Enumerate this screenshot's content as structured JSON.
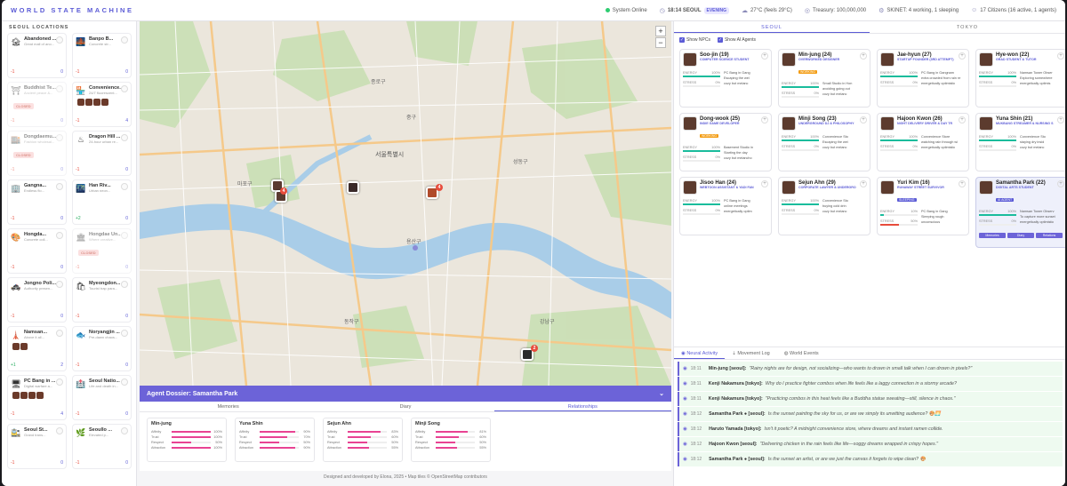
{
  "header": {
    "title": "WORLD STATE MACHINE",
    "system_status": "System Online",
    "time": "18:14 SEOUL",
    "time_badge": "EVENING",
    "weather": "27°C (feels 29°C)",
    "treasury": "Treasury: 100,000,000",
    "skinet": "SKINET: 4 working, 1 sleeping",
    "citizens": "17 Citizens (16 active, 1 agents)"
  },
  "locations": {
    "heading": "SEOUL LOCATIONS",
    "items": [
      {
        "name": "Abandoned ...",
        "sub": "Great mall of ano...",
        "icon": "🏚",
        "delta": "-1",
        "count": "0"
      },
      {
        "name": "Banpo B...",
        "sub": "Concrete str...",
        "icon": "🌉",
        "delta": "-1",
        "count": "0"
      },
      {
        "name": "Buddhist Te...",
        "sub": "Ancient peace &...",
        "icon": "⛩",
        "delta": "-1",
        "count": "0",
        "closed": "CLOSED"
      },
      {
        "name": "Convenience...",
        "sub": "24/7 fluorescent...",
        "icon": "🏪",
        "delta": "-1",
        "count": "4",
        "avatars": 4
      },
      {
        "name": "Dongdaemu...",
        "sub": "Fashion wholesal...",
        "icon": "🏬",
        "delta": "-1",
        "count": "0",
        "closed": "CLOSED"
      },
      {
        "name": "Dragon Hill ...",
        "sub": "24-hour urban re...",
        "icon": "♨",
        "delta": "-1",
        "count": "0"
      },
      {
        "name": "Gangna...",
        "sub": "Endless flo...",
        "icon": "🏢",
        "delta": "-1",
        "count": "0"
      },
      {
        "name": "Han Riv...",
        "sub": "Urban neon...",
        "icon": "🌃",
        "delta": "+2",
        "count": "0"
      },
      {
        "name": "Hongda...",
        "sub": "Concrete coll...",
        "icon": "🎨",
        "delta": "-1",
        "count": "0"
      },
      {
        "name": "Hongdae Un...",
        "sub": "Where creative...",
        "icon": "🏛",
        "delta": "-1",
        "count": "0",
        "closed": "CLOSED"
      },
      {
        "name": "Jongno Poli...",
        "sub": "Authority presen...",
        "icon": "🚓",
        "delta": "-1",
        "count": "0"
      },
      {
        "name": "Myeongdon...",
        "sub": "Tourist trap para...",
        "icon": "🛍",
        "delta": "-1",
        "count": "0"
      },
      {
        "name": "Namsan...",
        "sub": "Above it all...",
        "icon": "🗼",
        "delta": "+1",
        "count": "2",
        "avatars": 2
      },
      {
        "name": "Noryangjin ...",
        "sub": "Pre-dawn chaos...",
        "icon": "🐟",
        "delta": "-1",
        "count": "0"
      },
      {
        "name": "PC Bang in ...",
        "sub": "Digital warfare a...",
        "icon": "🖥",
        "delta": "-1",
        "count": "4",
        "avatars": 4
      },
      {
        "name": "Seoul Natio...",
        "sub": "Life and death in...",
        "icon": "🏥",
        "delta": "-1",
        "count": "0"
      },
      {
        "name": "Seoul St...",
        "sub": "Grand trans...",
        "icon": "🚉",
        "delta": "-1",
        "count": "0"
      },
      {
        "name": "Seoullo ...",
        "sub": "Elevated p...",
        "icon": "🌿",
        "delta": "-1",
        "count": "0"
      }
    ]
  },
  "map": {
    "zoom_in": "+",
    "zoom_out": "−",
    "labels": [
      "서울특별시",
      "용산구",
      "강남구",
      "마포구",
      "동작구",
      "종로구",
      "중구",
      "성동구"
    ]
  },
  "dossier": {
    "title": "Agent Dossier: Samantha Park",
    "tabs": [
      "Memories",
      "Diary",
      "Relationships"
    ],
    "active_tab": "Relationships",
    "relationships": [
      {
        "name": "Min-jung",
        "rows": [
          {
            "label": "Affinity",
            "value": "100%"
          },
          {
            "label": "Trust",
            "value": "100%"
          },
          {
            "label": "Respect",
            "value": "50%"
          },
          {
            "label": "Attraction",
            "value": "100%"
          }
        ]
      },
      {
        "name": "Yuna Shin",
        "rows": [
          {
            "label": "Affinity",
            "value": "90%"
          },
          {
            "label": "Trust",
            "value": "70%"
          },
          {
            "label": "Respect",
            "value": "50%"
          },
          {
            "label": "Attraction",
            "value": "90%"
          }
        ]
      },
      {
        "name": "Sejun Ahn",
        "rows": [
          {
            "label": "Affinity",
            "value": "83%"
          },
          {
            "label": "Trust",
            "value": "60%"
          },
          {
            "label": "Respect",
            "value": "50%"
          },
          {
            "label": "Attraction",
            "value": "55%"
          }
        ]
      },
      {
        "name": "Minji Song",
        "rows": [
          {
            "label": "Affinity",
            "value": "81%"
          },
          {
            "label": "Trust",
            "value": "60%"
          },
          {
            "label": "Respect",
            "value": "50%"
          },
          {
            "label": "Attraction",
            "value": "55%"
          }
        ]
      }
    ]
  },
  "footer": "Designed and developed by Elona, 2025 • Map tiles © OpenStreetMap contributors",
  "right": {
    "city_tabs": [
      "SEOUL",
      "TOKYO"
    ],
    "filters": [
      "Show NPCs",
      "Show AI Agents"
    ],
    "agents": [
      {
        "name": "Soo-jin (19)",
        "role": "COMPUTER SCIENCE STUDENT",
        "energy": "100%",
        "stress": "0%",
        "loc": "PC Bang in Gang",
        "act": "Escaping the wei",
        "mood": "cozy but melanc",
        "energy_v": 100,
        "stress_v": 0
      },
      {
        "name": "Min-jung (24)",
        "role": "OVERWORKED DESIGNER",
        "tag": "WORKING",
        "energy": "100%",
        "stress": "0%",
        "loc": "Small Studio in Hon",
        "act": "avoiding going out",
        "mood": "cozy but melanc",
        "energy_v": 100,
        "stress_v": 0
      },
      {
        "name": "Jae-hyun (27)",
        "role": "STARTUP FOUNDER (3RD ATTEMPT)",
        "energy": "100%",
        "stress": "0%",
        "loc": "PC Bang in Gangnam",
        "act": "extra crowded from rain re",
        "mood": "energetically optimistic",
        "energy_v": 100,
        "stress_v": 0
      },
      {
        "name": "Hye-won (22)",
        "role": "GRAD STUDENT & TUTOR",
        "energy": "100%",
        "stress": "0%",
        "loc": "Namsan Tower Obser",
        "act": "Exploring somewhere",
        "mood": "energetically optimis",
        "energy_v": 100,
        "stress_v": 0
      },
      {
        "name": "Dong-wook (25)",
        "role": "INDIE GAME DEVELOPER",
        "tag": "WORKING",
        "energy": "100%",
        "stress": "0%",
        "loc": "Basement Studio in",
        "act": "Starting the day",
        "mood": "cozy but melancho",
        "energy_v": 100,
        "stress_v": 0
      },
      {
        "name": "Minji Song (23)",
        "role": "UNDERGROUND DJ & PHILOSOPHY",
        "energy": "100%",
        "stress": "0%",
        "loc": "Convenience Sto",
        "act": "Escaping the wei",
        "mood": "cozy but melanc",
        "energy_v": 100,
        "stress_v": 0
      },
      {
        "name": "Hajoon Kwon (26)",
        "role": "NIGHT DELIVERY DRIVER & DAY TR",
        "energy": "100%",
        "stress": "0%",
        "loc": "Convenience Store",
        "act": "watching rain through wi",
        "mood": "energetically optimistic",
        "energy_v": 100,
        "stress_v": 0
      },
      {
        "name": "Yuna Shin (21)",
        "role": "MUKBANG STREAMER & NURSING S",
        "energy": "100%",
        "stress": "0%",
        "loc": "Convenience Sto",
        "act": "staying dry insid",
        "mood": "cozy but melanc",
        "energy_v": 100,
        "stress_v": 0
      },
      {
        "name": "Jisoo Han (24)",
        "role": "WEBTOON ASSISTANT & YADI FAN",
        "energy": "100%",
        "stress": "0%",
        "loc": "PC Bang in Gang",
        "act": "online meetings",
        "mood": "energetically optim",
        "energy_v": 100,
        "stress_v": 0
      },
      {
        "name": "Sejun Ahn (29)",
        "role": "CORPORATE LAWYER & UNDERGRO",
        "energy": "100%",
        "stress": "0%",
        "loc": "Convenience Sto",
        "act": "buying cold drin",
        "mood": "cozy but melanc",
        "energy_v": 100,
        "stress_v": 0
      },
      {
        "name": "Yuri Kim (16)",
        "role": "RUNAWAY STREET SURVIVOR",
        "tag": "SLEEPING",
        "energy": "10%",
        "stress": "50%",
        "loc": "PC Bang in Gang",
        "act": "Sleeping rough",
        "mood": "unconscious",
        "energy_v": 10,
        "stress_v": 50
      },
      {
        "name": "Samantha Park (22)",
        "role": "DIGITAL ARTS STUDENT",
        "tag": "AI AGENT",
        "energy": "100%",
        "stress": "0%",
        "loc": "Namsan Tower Observ",
        "act": "To capture more sunset",
        "mood": "energetically optimistic",
        "energy_v": 100,
        "stress_v": 0,
        "selected": true,
        "actions": [
          "Memories",
          "Diary",
          "Relations"
        ]
      }
    ]
  },
  "activity": {
    "tabs": [
      "Neural Activity",
      "Movement Log",
      "World Events"
    ],
    "active_tab": "Neural Activity",
    "rows": [
      {
        "time": "18:11",
        "agent": "Min-jung [seoul]:",
        "msg": "\"Rainy nights are for design, not socializing—who wants to drown in small talk when I can drown in pixels?\""
      },
      {
        "time": "18:11",
        "agent": "Kenji Nakamura [tokyo]:",
        "msg": "Why do I practice fighter combos when life feels like a laggy connection in a stormy arcade?"
      },
      {
        "time": "18:11",
        "agent": "Kenji Nakamura [tokyo]:",
        "msg": "\"Practicing combos in this heat feels like a Buddha statue sweating—still, silence in chaos.\""
      },
      {
        "time": "18:12",
        "agent": "Samantha Park ● [seoul]:",
        "msg": "Is the sunset painting the sky for us, or are we simply its unwitting audience? 🎨🌅"
      },
      {
        "time": "18:12",
        "agent": "Haruto Yamada [tokyo]:",
        "msg": "Isn't it poetic? A midnight convenience store, where dreams and instant ramen collide."
      },
      {
        "time": "18:12",
        "agent": "Hajoon Kwon [seoul]:",
        "msg": "\"Delivering chicken in the rain feels like life—soggy dreams wrapped in crispy hopes.\""
      },
      {
        "time": "18:12",
        "agent": "Samantha Park ● [seoul]:",
        "msg": "Is the sunset an artist, or are we just the canvas it forgets to wipe clean? 🎨"
      }
    ]
  }
}
